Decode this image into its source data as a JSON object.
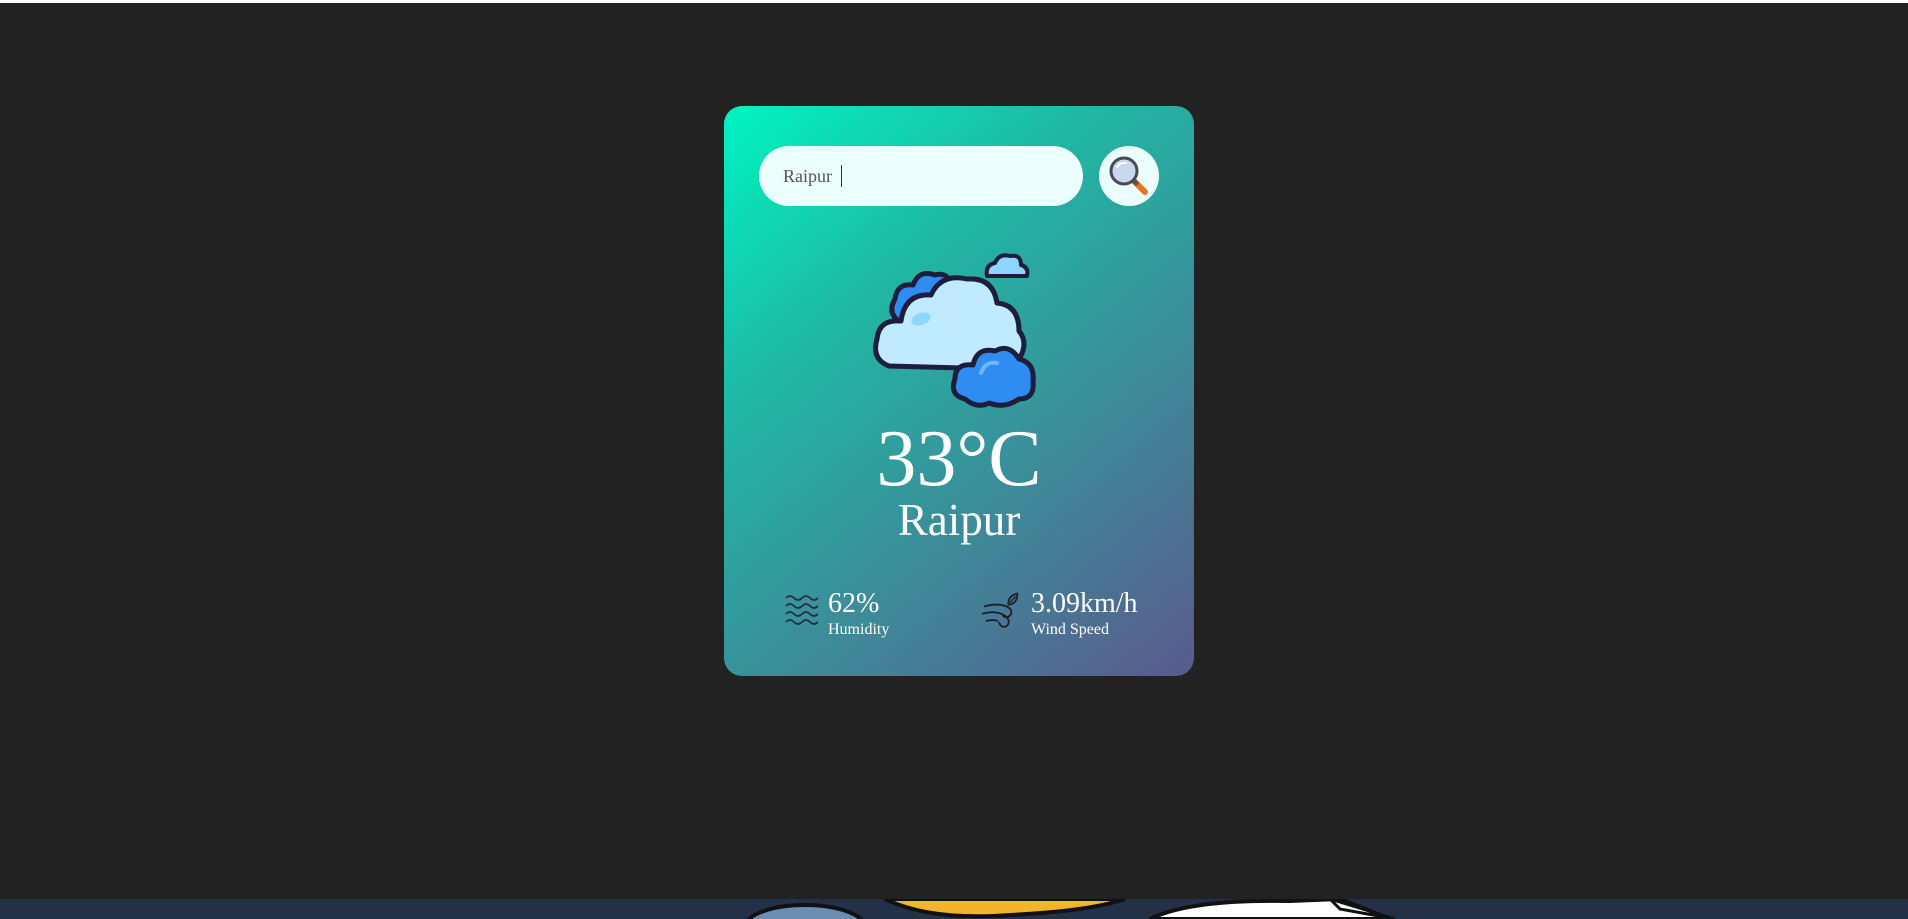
{
  "search": {
    "value": "Raipur",
    "placeholder": ""
  },
  "weather": {
    "icon": "clouds-icon",
    "temperature": "33°C",
    "city": "Raipur"
  },
  "details": {
    "humidity": {
      "value": "62%",
      "label": "Humidity",
      "icon": "humidity-waves-icon"
    },
    "wind": {
      "value": "3.09km/h",
      "label": "Wind Speed",
      "icon": "wind-icon"
    }
  },
  "colors": {
    "page_background": "#222222",
    "card_gradient_start": "#00f5c0",
    "card_gradient_end": "#5a5a8c",
    "input_background": "#ebfffc",
    "text": "#ffffff"
  }
}
